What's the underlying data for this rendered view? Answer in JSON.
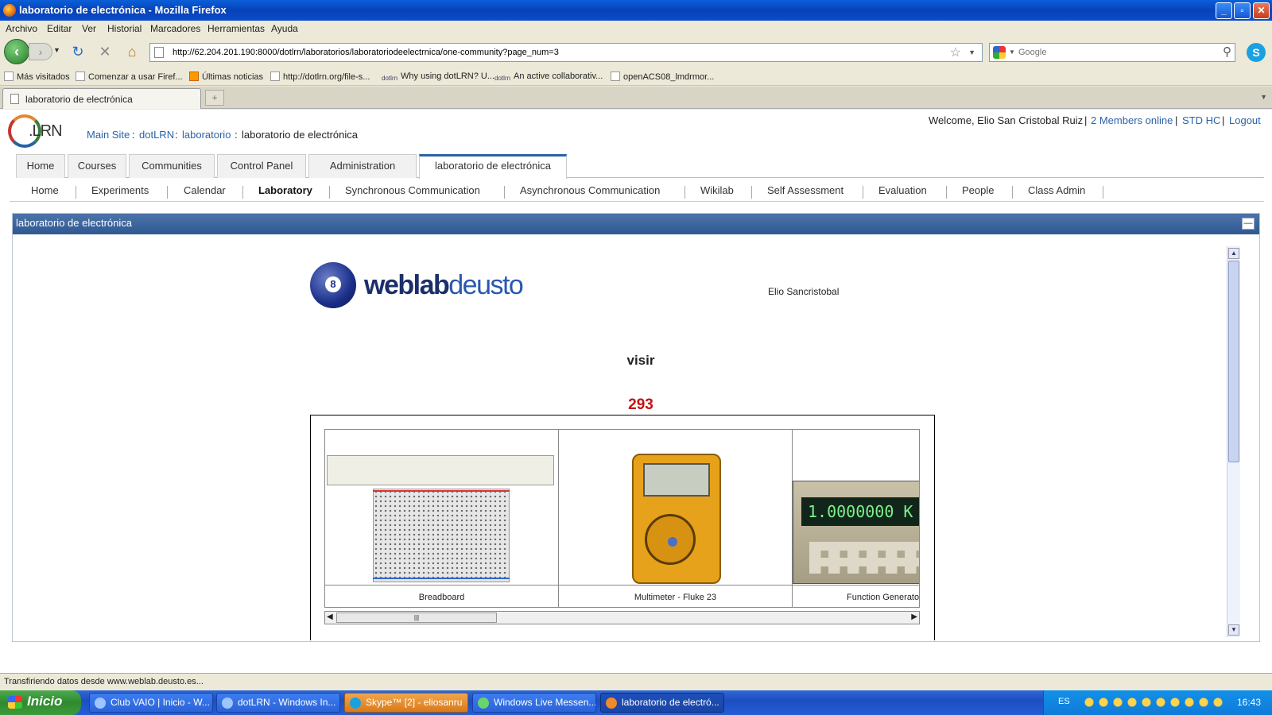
{
  "window": {
    "title": "laboratorio de electrónica - Mozilla Firefox",
    "minimize": "_",
    "maximize": "▫",
    "close": "✕"
  },
  "menu": [
    "Archivo",
    "Editar",
    "Ver",
    "Historial",
    "Marcadores",
    "Herramientas",
    "Ayuda"
  ],
  "nav": {
    "url": "http://62.204.201.190:8000/dotlrn/laboratorios/laboratoriodeelectrnica/one-community?page_num=3",
    "search_placeholder": "Google"
  },
  "bookmarks": [
    "Más visitados",
    "Comenzar a usar Firef...",
    "Últimas noticias",
    "http://dotlrn.org/file-s...",
    "Why using dotLRN? U...",
    "An active collaborativ...",
    "openACS08_lmdrmor..."
  ],
  "tabs": {
    "active": "laboratorio de electrónica",
    "new_tab": "+"
  },
  "site": {
    "logo_text": ".LRN",
    "breadcrumb": {
      "main_site": "Main Site",
      "sep": ":",
      "dotlrn": "dotLRN",
      "laboratorio": "laboratorio",
      "current": "laboratorio de electrónica"
    },
    "user": {
      "welcome": "Welcome, Elio San Cristobal Ruiz",
      "sep": "|",
      "members_online": "2 Members online",
      "std_hc": "STD HC",
      "logout": "Logout"
    }
  },
  "main_tabs": [
    "Home",
    "Courses",
    "Communities",
    "Control Panel",
    "Administration",
    "laboratorio de electrónica"
  ],
  "sub_tabs": [
    "Home",
    "Experiments",
    "Calendar",
    "Laboratory",
    "Synchronous Communication",
    "Asynchronous Communication",
    "Wikilab",
    "Self Assessment",
    "Evaluation",
    "People",
    "Class Admin"
  ],
  "portlet": {
    "title": "laboratorio de electrónica",
    "minimize": "—"
  },
  "weblab": {
    "ball_number": "8",
    "brand_part1": "weblab",
    "brand_part2": "deusto",
    "user_name": "Elio Sancristobal",
    "experiment": "visir",
    "counter": "293",
    "instruments": [
      "Breadboard",
      "Multimeter - Fluke 23",
      "Function Generator"
    ],
    "fg_display": "1.0000000 K"
  },
  "status": "Transfiriendo datos desde www.weblab.deusto.es...",
  "taskbar": {
    "start": "Inicio",
    "tasks": [
      "Club VAIO | Inicio - W...",
      "dotLRN - Windows In...",
      "Skype™ [2] - eliosanru",
      "Windows Live Messen...",
      "laboratorio de electró..."
    ],
    "lang": "ES",
    "clock": "16:43"
  },
  "colors": {
    "link": "#2a63a8",
    "portlet_header": "#3b6299",
    "counter": "#c81010"
  }
}
